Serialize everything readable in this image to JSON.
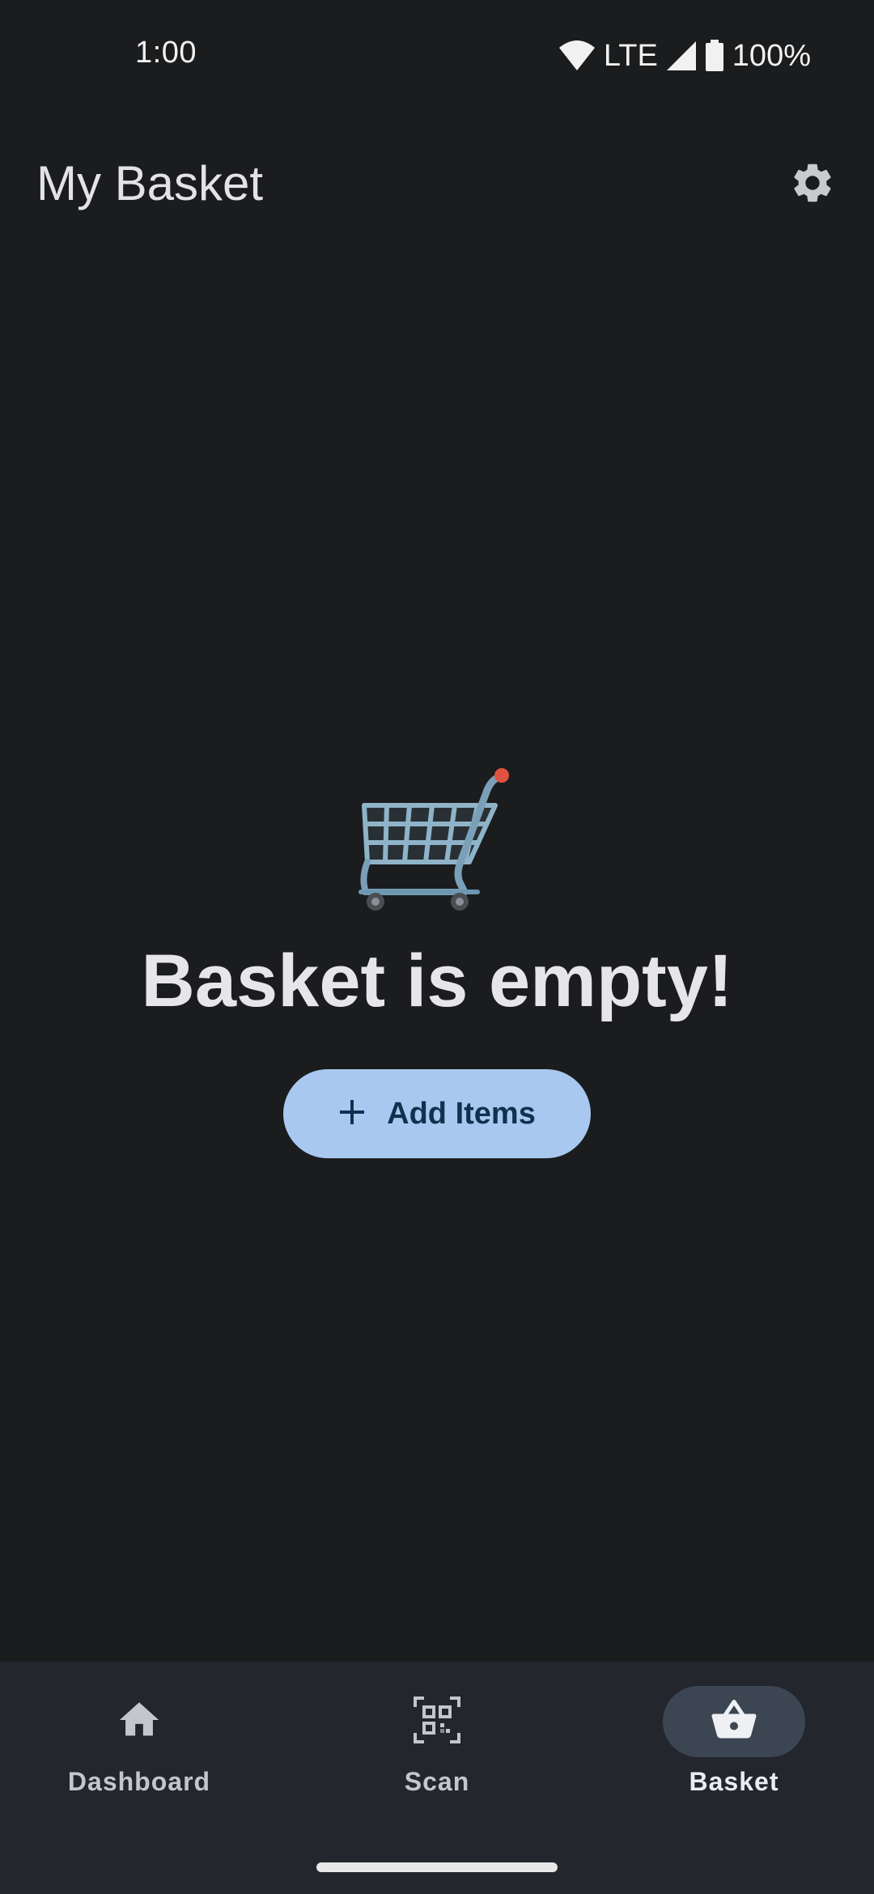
{
  "status_bar": {
    "time": "1:00",
    "network": "LTE",
    "battery": "100%",
    "icons": [
      "wifi-icon",
      "cell-signal-icon",
      "battery-icon"
    ]
  },
  "app_bar": {
    "title": "My Basket",
    "settings_icon": "gear-icon"
  },
  "empty_state": {
    "illustration": "shopping-cart-icon",
    "title": "Basket is empty!",
    "button_label": "Add Items",
    "button_icon": "plus-icon"
  },
  "bottom_nav": {
    "items": [
      {
        "label": "Dashboard",
        "icon": "home-icon",
        "active": false
      },
      {
        "label": "Scan",
        "icon": "qr-scan-icon",
        "active": false
      },
      {
        "label": "Basket",
        "icon": "basket-icon",
        "active": true
      }
    ]
  },
  "colors": {
    "background": "#1b1c1e",
    "nav_background": "#24262d",
    "button_background": "#a8c8f0",
    "button_text": "#12314f",
    "active_indicator": "#3c4653"
  }
}
